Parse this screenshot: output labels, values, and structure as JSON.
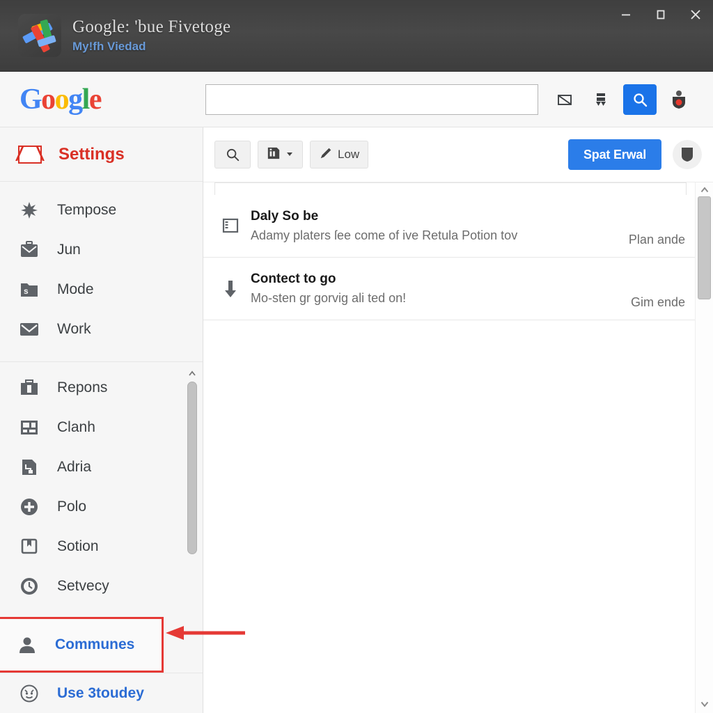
{
  "window": {
    "title_main": "Google: 'bue Fivetoge",
    "title_sub": "My!fh Viedad",
    "controls": {
      "minimize": "minimize-icon",
      "maximize": "maximize-icon",
      "close": "close-icon"
    }
  },
  "header": {
    "logo_letters": [
      "G",
      "o",
      "o",
      "g",
      "l",
      "e"
    ],
    "search": {
      "value": "",
      "placeholder": ""
    },
    "icons": [
      "mail-icon",
      "archive-icon",
      "search-icon",
      "account-shield-icon"
    ]
  },
  "sidebar": {
    "brand": {
      "label": "Settings",
      "icon": "gmail-icon",
      "color": "#d93025"
    },
    "group_top": [
      {
        "label": "Tempose",
        "icon": "sparkle-icon"
      },
      {
        "label": "Jun",
        "icon": "briefcase-mail-icon"
      },
      {
        "label": "Mode",
        "icon": "folder-s-icon"
      },
      {
        "label": "Work",
        "icon": "envelope-icon"
      }
    ],
    "group_main": [
      {
        "label": "Repons",
        "icon": "toolbox-icon"
      },
      {
        "label": "Clanh",
        "icon": "grid-photo-icon"
      },
      {
        "label": "Adria",
        "icon": "document-flow-icon"
      },
      {
        "label": "Polo",
        "icon": "plus-circle-icon"
      },
      {
        "label": "Sotion",
        "icon": "bookmark-box-icon"
      },
      {
        "label": "Setvecy",
        "icon": "clock-icon"
      }
    ],
    "highlighted": {
      "label": "Communes",
      "icon": "person-icon",
      "color": "#2b6cd4"
    },
    "bottom": {
      "label": "Use 3toudey",
      "icon": "face-circle-icon",
      "color": "#2b6cd4"
    },
    "scrollbar": {
      "up_arrow": "chevron-up-icon"
    }
  },
  "toolbar": {
    "search_label": "",
    "search_icon": "search-icon",
    "dropdown_icon": "card-icon",
    "dropdown_caret": "caret-down-icon",
    "edit_icon": "pencil-icon",
    "edit_label": "Low",
    "primary_label": "Spat Erwal",
    "primary_color": "#2b7de9",
    "avatar_icon": "shield-avatar-icon"
  },
  "mail_list": {
    "rows": [
      {
        "icon": "list-note-icon",
        "subject": "Daly So be",
        "snippet": "Adamy platers ſee come of ive Retula Potion tov",
        "meta": "Plan ande"
      },
      {
        "icon": "download-arrow-icon",
        "subject": "Contect to go",
        "snippet": "Mo-sten gr gorvig ali ted on!",
        "meta": "Gim ende"
      }
    ],
    "scrollbar": {
      "up_arrow": "chevron-up-icon",
      "down_arrow": "chevron-down-icon"
    }
  },
  "annotation": {
    "type": "arrow-left",
    "color": "#e53935",
    "points_to": "Communes"
  }
}
